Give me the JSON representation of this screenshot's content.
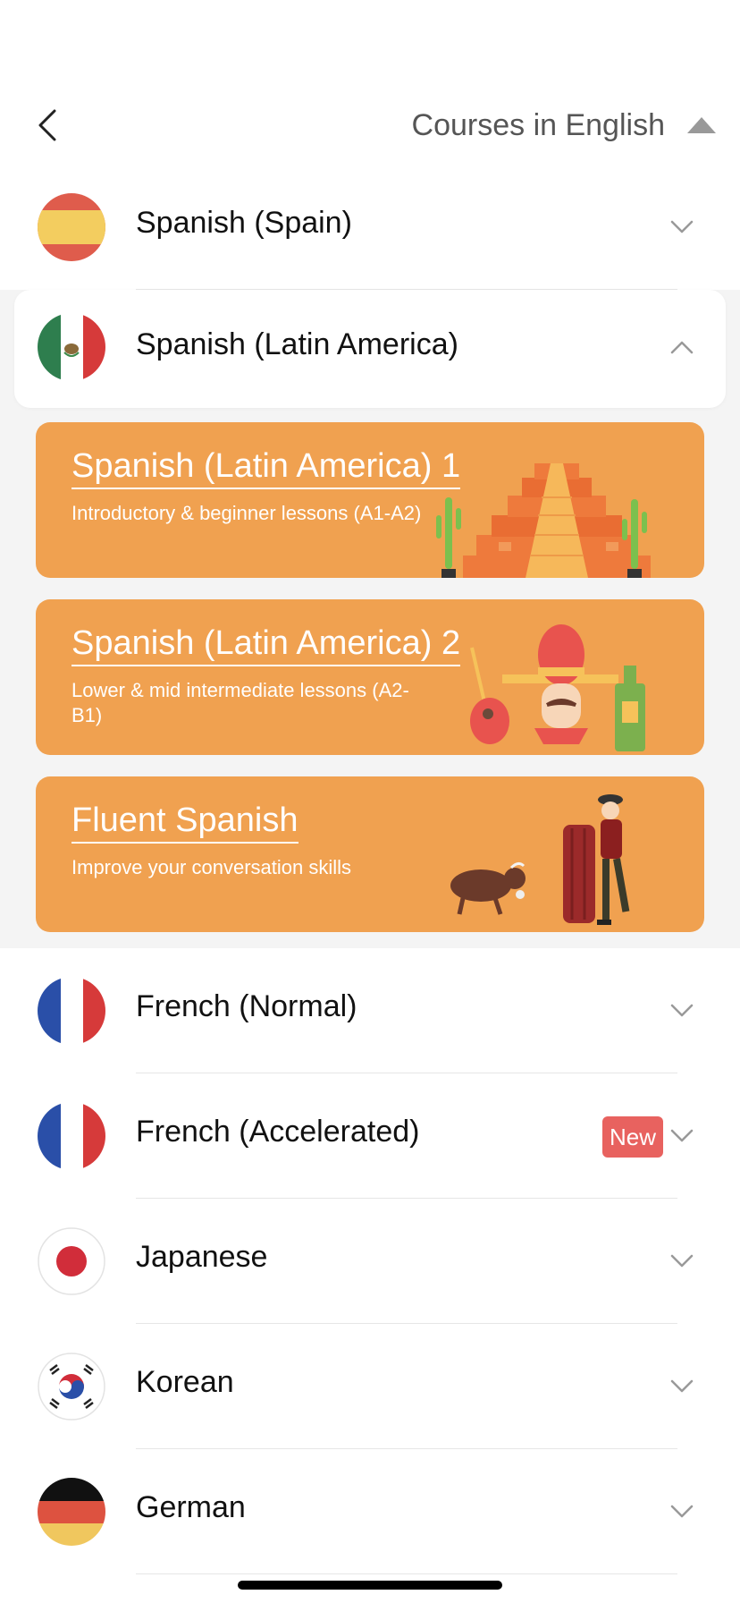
{
  "header": {
    "title": "Courses in English",
    "back_icon": "chevron-left-icon",
    "toggle_icon": "caret-up-icon"
  },
  "languages": [
    {
      "name": "Spanish (Spain)",
      "flag": "spain-flag-icon",
      "expanded": false
    },
    {
      "name": "Spanish (Latin America)",
      "flag": "mexico-flag-icon",
      "expanded": true
    },
    {
      "name": "French (Normal)",
      "flag": "france-flag-icon",
      "expanded": false
    },
    {
      "name": "French (Accelerated)",
      "flag": "france-flag-icon",
      "expanded": false,
      "badge": "New"
    },
    {
      "name": "Japanese",
      "flag": "japan-flag-icon",
      "expanded": false
    },
    {
      "name": "Korean",
      "flag": "korea-flag-icon",
      "expanded": false
    },
    {
      "name": "German",
      "flag": "germany-flag-icon",
      "expanded": false
    }
  ],
  "courses": [
    {
      "title": "Spanish (Latin America) 1",
      "subtitle": "Introductory & beginner lessons (A1-A2)",
      "illustration": "pyramid-cactus-illustration"
    },
    {
      "title": "Spanish (Latin America) 2",
      "subtitle": "Lower & mid intermediate lessons (A2-B1)",
      "illustration": "sombrero-guitar-illustration"
    },
    {
      "title": "Fluent Spanish",
      "subtitle": "Improve your conversation skills",
      "illustration": "bullfighter-illustration"
    }
  ],
  "colors": {
    "card": "#f0a150",
    "badge": "#e8625f",
    "section_bg": "#f4f4f4"
  }
}
